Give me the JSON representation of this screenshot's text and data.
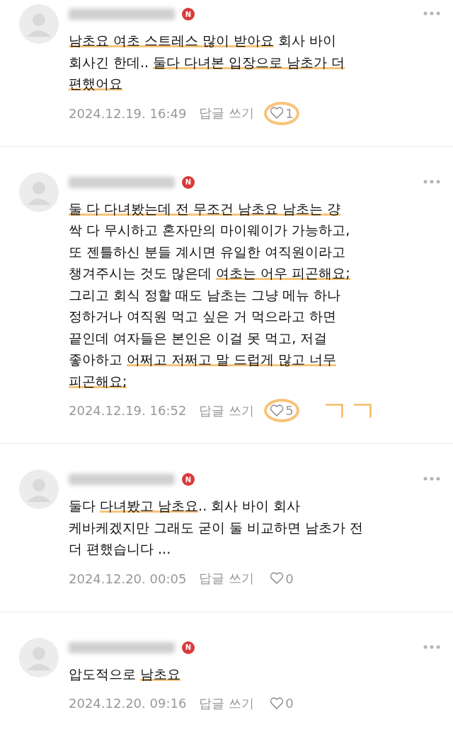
{
  "comments": [
    {
      "lines": [
        [
          {
            "text": "남초요 여초 스트레스 많이 받아요",
            "marked": true
          },
          {
            "text": " 회사 바이",
            "marked": false
          }
        ],
        [
          {
            "text": "회사긴 한데.. ",
            "marked": false
          },
          {
            "text": "둘다 다녀본 입장으로 남초가 더",
            "marked": true
          }
        ],
        [
          {
            "text": "편했어요",
            "marked": true
          }
        ]
      ],
      "badge": "N",
      "date": "2024.12.19. 16:49",
      "reply": "답글 쓰기",
      "likes": "1",
      "circled": true
    },
    {
      "lines": [
        [
          {
            "text": "둘 다 다녀봤는데 전 무조건 남초요 남초는 걍",
            "marked": true
          }
        ],
        [
          {
            "text": "싹 다 무시하고 혼자만의 마이웨이가 가능하고,",
            "marked": false
          }
        ],
        [
          {
            "text": "또 젠틀하신 분들 계시면 유일한 여직원이라고",
            "marked": false
          }
        ],
        [
          {
            "text": "챙겨주시는 것도 많은데 ",
            "marked": false
          },
          {
            "text": "여초는 어우 피곤해요;",
            "marked": true
          }
        ],
        [
          {
            "text": "그리고 회식 정할 때도 남초는 그냥 메뉴 하나",
            "marked": false
          }
        ],
        [
          {
            "text": "정하거나 여직원 먹고 싶은 거 먹으라고 하면",
            "marked": false
          }
        ],
        [
          {
            "text": "끝인데 여자들은 본인은 이걸 못 먹고, 저걸",
            "marked": false
          }
        ],
        [
          {
            "text": "좋아하고 ",
            "marked": false
          },
          {
            "text": "어쩌고 저쩌고 말 드럽게 많고 너무",
            "marked": true
          }
        ],
        [
          {
            "text": "피곤해요;",
            "marked": true
          }
        ]
      ],
      "badge": "N",
      "date": "2024.12.19. 16:52",
      "reply": "답글 쓰기",
      "likes": "5",
      "circled": true,
      "scribble": "ㄱㄱ"
    },
    {
      "lines": [
        [
          {
            "text": "둘다 ",
            "marked": false
          },
          {
            "text": "다녀봤고 남초요",
            "marked": true
          },
          {
            "text": ".. 회사 바이 회사",
            "marked": false
          }
        ],
        [
          {
            "text": "케바케겠지만 그래도 굳이 둘 비교하면 남초가 전",
            "marked": false
          }
        ],
        [
          {
            "text": "더 편했습니다 ...",
            "marked": false
          }
        ]
      ],
      "badge": "N",
      "date": "2024.12.20. 00:05",
      "reply": "답글 쓰기",
      "likes": "0",
      "circled": false
    },
    {
      "lines": [
        [
          {
            "text": "압도적으로 ",
            "marked": false
          },
          {
            "text": "남초요",
            "marked": true
          }
        ]
      ],
      "badge": "N",
      "date": "2024.12.20. 09:16",
      "reply": "답글 쓰기",
      "likes": "0",
      "circled": false
    }
  ]
}
